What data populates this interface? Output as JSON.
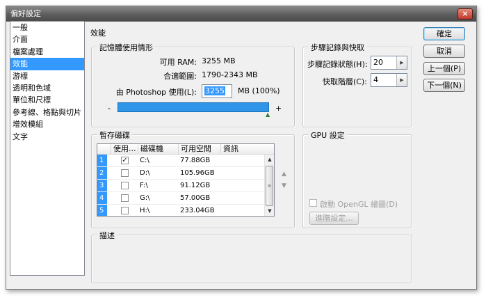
{
  "window": {
    "title": "偏好設定",
    "close_label": "×"
  },
  "sidebar": {
    "items": [
      {
        "label": "一般"
      },
      {
        "label": "介面"
      },
      {
        "label": "檔案處理"
      },
      {
        "label": "效能",
        "selected": true
      },
      {
        "label": "游標"
      },
      {
        "label": "透明和色域"
      },
      {
        "label": "單位和尺標"
      },
      {
        "label": "參考線、格點與切片"
      },
      {
        "label": "增效模組"
      },
      {
        "label": "文字"
      }
    ]
  },
  "section_title": "效能",
  "memory": {
    "legend": "記憶體使用情形",
    "available_label": "可用 RAM:",
    "available_value": "3255 MB",
    "ideal_label": "合適範圍:",
    "ideal_value": "1790-2343 MB",
    "use_label": "由 Photoshop 使用(L):",
    "use_value": "3255",
    "use_unit": "MB (100%)",
    "slider_min": "-",
    "slider_max": "+",
    "slider_fraction": 1.0
  },
  "history": {
    "legend": "步驟記錄與快取",
    "states_label": "步驟記錄狀態(H):",
    "states_value": "20",
    "cache_label": "快取階層(C):",
    "cache_value": "4"
  },
  "scratch": {
    "legend": "暫存磁碟",
    "columns": [
      "使用...",
      "磁碟機",
      "可用空間",
      "資訊"
    ],
    "rows": [
      {
        "num": "1",
        "checked": true,
        "drive": "C:\\",
        "free": "77.88GB",
        "info": ""
      },
      {
        "num": "2",
        "checked": false,
        "drive": "D:\\",
        "free": "105.96GB",
        "info": ""
      },
      {
        "num": "3",
        "checked": false,
        "drive": "F:\\",
        "free": "91.12GB",
        "info": ""
      },
      {
        "num": "4",
        "checked": false,
        "drive": "G:\\",
        "free": "57.00GB",
        "info": ""
      },
      {
        "num": "5",
        "checked": false,
        "drive": "H:\\",
        "free": "233.04GB",
        "info": ""
      }
    ]
  },
  "gpu": {
    "legend": "GPU 設定",
    "opengl_label": "啟動 OpenGL 繪圖(D)",
    "advanced_label": "進階設定..."
  },
  "description": {
    "legend": "描述"
  },
  "buttons": {
    "ok": "確定",
    "cancel": "取消",
    "prev": "上一個(P)",
    "next": "下一個(N)"
  },
  "colors": {
    "accent": "#3399ff",
    "titlebar": "#5d5d5d"
  }
}
